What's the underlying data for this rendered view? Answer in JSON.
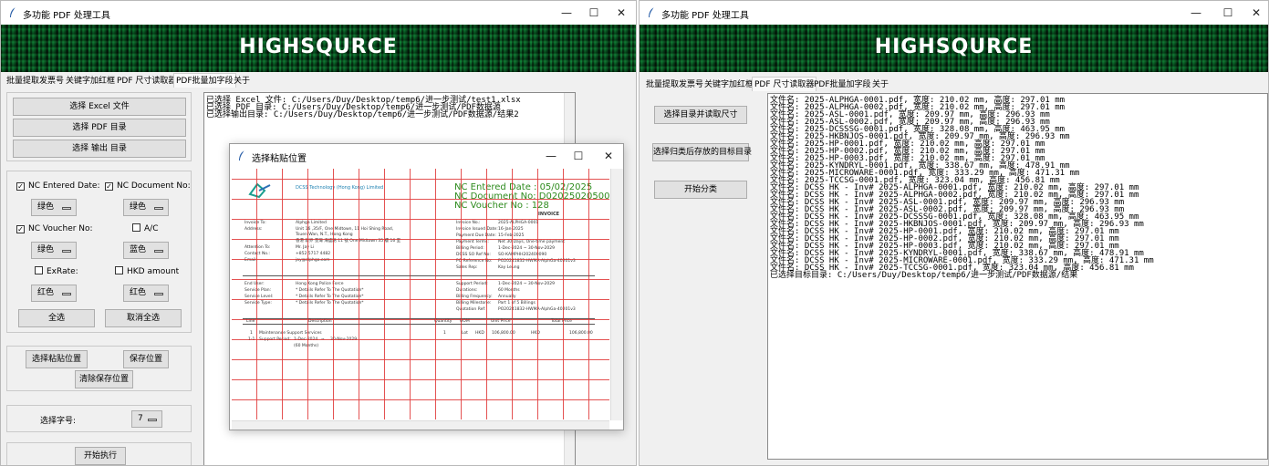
{
  "left_window": {
    "title": "多功能 PDF 处理工具",
    "controls": {
      "minimize": "—",
      "maximize": "☐",
      "close": "✕"
    },
    "banner_text": "HIGHSQURCE",
    "tabs": [
      "批量提取发票号",
      "关键字加红框",
      "PDF 尺寸读取器",
      "PDF批量加字段",
      "关于"
    ],
    "active_tab_index": 3,
    "buttons": {
      "select_excel": "选择 Excel 文件",
      "select_pdf_dir": "选择 PDF 目录",
      "select_output_dir": "选择 输出 目录",
      "select_all": "全选",
      "deselect_all": "取消全选",
      "select_paste_pos": "选择粘贴位置",
      "save_pos": "保存位置",
      "clear_saved_pos": "清除保存位置",
      "execute": "开始执行"
    },
    "fields": [
      {
        "label": "NC Entered Date:",
        "checked": true,
        "color": "绿色"
      },
      {
        "label": "NC Document No:",
        "checked": true,
        "color": "绿色"
      },
      {
        "label": "NC Voucher No:",
        "checked": true,
        "color": "绿色"
      },
      {
        "label": "A/C",
        "checked": false,
        "color": "蓝色"
      },
      {
        "label": "ExRate:",
        "checked": false,
        "color": "红色"
      },
      {
        "label": "HKD amount",
        "checked": false,
        "color": "红色"
      }
    ],
    "font_size_label": "选择字号:",
    "font_size_value": "7",
    "log_lines": [
      "已选择 Excel 文件: C:/Users/Duy/Desktop/temp6/进一步测试/test1.xlsx",
      "已选择 PDF 目录: C:/Users/Duy/Desktop/temp6/进一步测试/PDF数据源",
      "已选择输出目录: C:/Users/Duy/Desktop/temp6/进一步测试/PDF数据源/结果2"
    ]
  },
  "dialog": {
    "title": "选择粘贴位置",
    "controls": {
      "minimize": "—",
      "maximize": "☐",
      "close": "✕"
    },
    "overlay": {
      "entered_date": "NC Entered Date : 05/02/2025",
      "document_no": "NC Document No: D0202502050002380",
      "voucher_no": "NC Voucher No : 128"
    },
    "invoice": {
      "company": "DCSS Technology (Hong Kong) Limited",
      "heading": "INVOICE",
      "left_rows": [
        [
          "Invoice To:",
          "Alphga Limited"
        ],
        [
          "Address:",
          "Unit 16 ,35/F, One Midtown, 11 Hoi Shing Road,"
        ],
        [
          "",
          "Tsuen Wan, N.T., Hong Kong"
        ],
        [
          "",
          "香港 新界 荃灣 海盛路 11 號 One Midtown 35 樓 16 室"
        ],
        [
          "Attention To:",
          "Mr. Jay Li"
        ],
        [
          "Contact No.:",
          "+852 5717 4482"
        ],
        [
          "Email:",
          "jay@alphga.com"
        ],
        [
          "End User:",
          "Hong Kong Police Force"
        ],
        [
          "Service Plan:",
          "* Details Refer To The Quotation*"
        ],
        [
          "Service Level:",
          "* Details Refer To The Quotation*"
        ],
        [
          "Service Type:",
          "* Details Refer To The Quotation*"
        ]
      ],
      "right_rows": [
        [
          "Invoice No.:",
          "2025-ALPHGA-0001"
        ],
        [
          "Invoice Issued Date:",
          "16-Jan-2025"
        ],
        [
          "Payment Due Date:",
          "15-Feb-2025"
        ],
        [
          "Payment Terms:",
          "Net 30 Days, One-time payment"
        ],
        [
          "Billing Period:",
          "1-Dec-2024 ~ 30-Nov-2029"
        ],
        [
          "DCSS SO Ref No:",
          "SO-KAMPHH202400090"
        ],
        [
          "PO Reference No:",
          "PO20241832-HWMA-AlphGa-40201v3"
        ],
        [
          "Sales Rep:",
          "Kay Leung"
        ],
        [
          "Support Period:",
          "1-Dec-2024 ~ 30-Nov-2029"
        ],
        [
          "Durations:",
          "60 Months"
        ],
        [
          "Billing Frequency:",
          "Annually"
        ],
        [
          "Billing Milestone:",
          "Part 1 of 5 Billings"
        ],
        [
          "Quotation Ref:",
          "PO20241832-HWMA-AlphGa-40201v3"
        ]
      ],
      "table_headers": [
        "Line",
        "Description",
        "Quantity",
        "UOM",
        "Unit Price",
        "Total Price"
      ],
      "line1": [
        "1",
        "Maintenance Support Services",
        "1",
        "Lot",
        "HKD",
        "106,800.00",
        "HKD",
        "106,800.00"
      ],
      "line1_1": [
        "1-1",
        "Support Period:",
        "1-Dec-2024",
        "~",
        "30-Nov-2029"
      ],
      "line1_1_cont": "(60 Months)"
    }
  },
  "right_window": {
    "title": "多功能 PDF 处理工具",
    "controls": {
      "minimize": "—",
      "maximize": "☐",
      "close": "✕"
    },
    "banner_text": "HIGHSQURCE",
    "tabs": [
      "批量提取发票号",
      "关键字加红框",
      "PDF 尺寸读取器",
      "PDF批量加字段",
      "关于"
    ],
    "active_tab_index": 2,
    "buttons": {
      "select_dir_read": "选择目录并读取尺寸",
      "select_target_dir": "选择归类后存放的目标目录",
      "start_classify": "开始分类"
    },
    "output_lines": [
      "文件名: 2025-ALPHGA-0001.pdf, 宽度: 210.02 mm, 高度: 297.01 mm",
      "文件名: 2025-ALPHGA-0002.pdf, 宽度: 210.02 mm, 高度: 297.01 mm",
      "文件名: 2025-ASL-0001.pdf, 宽度: 209.97 mm, 高度: 296.93 mm",
      "文件名: 2025-ASL-0002.pdf, 宽度: 209.97 mm, 高度: 296.93 mm",
      "文件名: 2025-DCSSSG-0001.pdf, 宽度: 328.08 mm, 高度: 463.95 mm",
      "文件名: 2025-HKBNJOS-0001.pdf, 宽度: 209.97 mm, 高度: 296.93 mm",
      "文件名: 2025-HP-0001.pdf, 宽度: 210.02 mm, 高度: 297.01 mm",
      "文件名: 2025-HP-0002.pdf, 宽度: 210.02 mm, 高度: 297.01 mm",
      "文件名: 2025-HP-0003.pdf, 宽度: 210.02 mm, 高度: 297.01 mm",
      "文件名: 2025-KYNDRYL-0001.pdf, 宽度: 338.67 mm, 高度: 478.91 mm",
      "文件名: 2025-MICROWARE-0001.pdf, 宽度: 333.29 mm, 高度: 471.31 mm",
      "文件名: 2025-TCCSG-0001.pdf, 宽度: 323.04 mm, 高度: 456.81 mm",
      "文件名: DCSS HK - Inv# 2025-ALPHGA-0001.pdf, 宽度: 210.02 mm, 高度: 297.01 mm",
      "文件名: DCSS HK - Inv# 2025-ALPHGA-0002.pdf, 宽度: 210.02 mm, 高度: 297.01 mm",
      "文件名: DCSS HK - Inv# 2025-ASL-0001.pdf, 宽度: 209.97 mm, 高度: 296.93 mm",
      "文件名: DCSS HK - Inv# 2025-ASL-0002.pdf, 宽度: 209.97 mm, 高度: 296.93 mm",
      "文件名: DCSS HK - Inv# 2025-DCSSSG-0001.pdf, 宽度: 328.08 mm, 高度: 463.95 mm",
      "文件名: DCSS HK - Inv# 2025-HKBNJOS-0001.pdf, 宽度: 209.97 mm, 高度: 296.93 mm",
      "文件名: DCSS HK - Inv# 2025-HP-0001.pdf, 宽度: 210.02 mm, 高度: 297.01 mm",
      "文件名: DCSS HK - Inv# 2025-HP-0002.pdf, 宽度: 210.02 mm, 高度: 297.01 mm",
      "文件名: DCSS HK - Inv# 2025-HP-0003.pdf, 宽度: 210.02 mm, 高度: 297.01 mm",
      "文件名: DCSS HK - Inv# 2025-KYNDRYL-0001.pdf, 宽度: 338.67 mm, 高度: 478.91 mm",
      "文件名: DCSS HK - Inv# 2025-MICROWARE-0001.pdf, 宽度: 333.29 mm, 高度: 471.31 mm",
      "文件名: DCSS HK - Inv# 2025-TCCSG-0001.pdf, 宽度: 323.04 mm, 高度: 456.81 mm",
      "已选择目标目录: C:/Users/Duy/Desktop/temp6/进一步测试/PDF数据源/结果"
    ]
  }
}
